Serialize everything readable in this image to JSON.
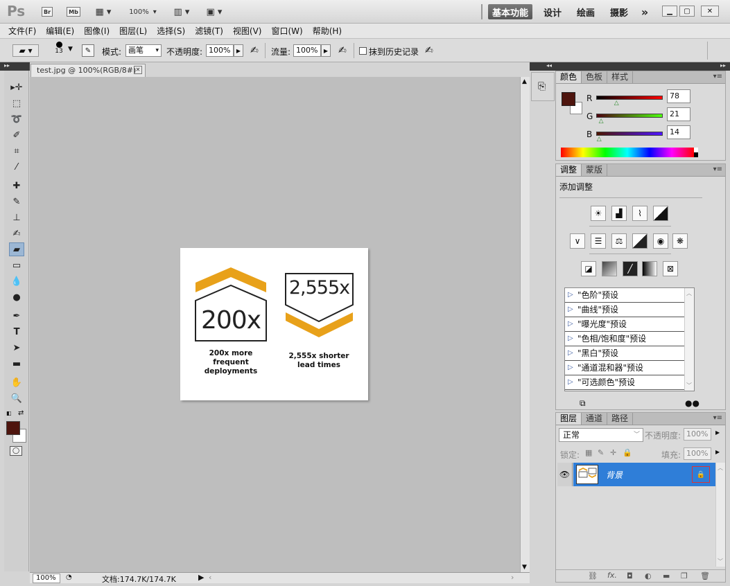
{
  "titlebar": {
    "app_logo": "Ps",
    "bridge_label": "Br",
    "minibridge_label": "Mb",
    "zoom": "100%",
    "workspaces": [
      "基本功能",
      "设计",
      "绘画",
      "摄影"
    ],
    "more": "»"
  },
  "menubar": [
    "文件(F)",
    "编辑(E)",
    "图像(I)",
    "图层(L)",
    "选择(S)",
    "滤镜(T)",
    "视图(V)",
    "窗口(W)",
    "帮助(H)"
  ],
  "options": {
    "brush_size": "13",
    "mode_label": "模式:",
    "mode_value": "画笔",
    "opacity_label": "不透明度:",
    "opacity_value": "100%",
    "flow_label": "流量:",
    "flow_value": "100%",
    "erase_history_label": "抹到历史记录"
  },
  "document": {
    "tab_title": "test.jpg @ 100%(RGB/8#)",
    "zoom": "100%",
    "doc_info": "文档:174.7K/174.7K"
  },
  "image_content": {
    "left_number": "200x",
    "left_caption": "200x more frequent deployments",
    "right_number": "2,555x",
    "right_caption": "2,555x shorter lead times"
  },
  "color_panel": {
    "tabs": [
      "颜色",
      "色板",
      "样式"
    ],
    "r_label": "R",
    "r_value": "78",
    "g_label": "G",
    "g_value": "21",
    "b_label": "B",
    "b_value": "14",
    "r_fraction": 0.31,
    "g_fraction": 0.08,
    "b_fraction": 0.05,
    "foreground": "#4e150e",
    "background": "#ffffff"
  },
  "adjust_panel": {
    "tabs": [
      "调整",
      "蒙版"
    ],
    "heading": "添加调整",
    "presets": [
      "\"色阶\"预设",
      "\"曲线\"预设",
      "\"曝光度\"预设",
      "\"色相/饱和度\"预设",
      "\"黑白\"预设",
      "\"通道混和器\"预设",
      "\"可选颜色\"预设"
    ]
  },
  "layers_panel": {
    "tabs": [
      "图层",
      "通道",
      "路径"
    ],
    "blend_mode": "正常",
    "opacity_label": "不透明度:",
    "opacity_value": "100%",
    "lock_label": "锁定:",
    "fill_label": "填充:",
    "fill_value": "100%",
    "layer_name": "背景",
    "footer_fx": "fx."
  },
  "colors": {
    "accent_gold": "#e8a11a",
    "layer_selected": "#2f7ed8"
  }
}
